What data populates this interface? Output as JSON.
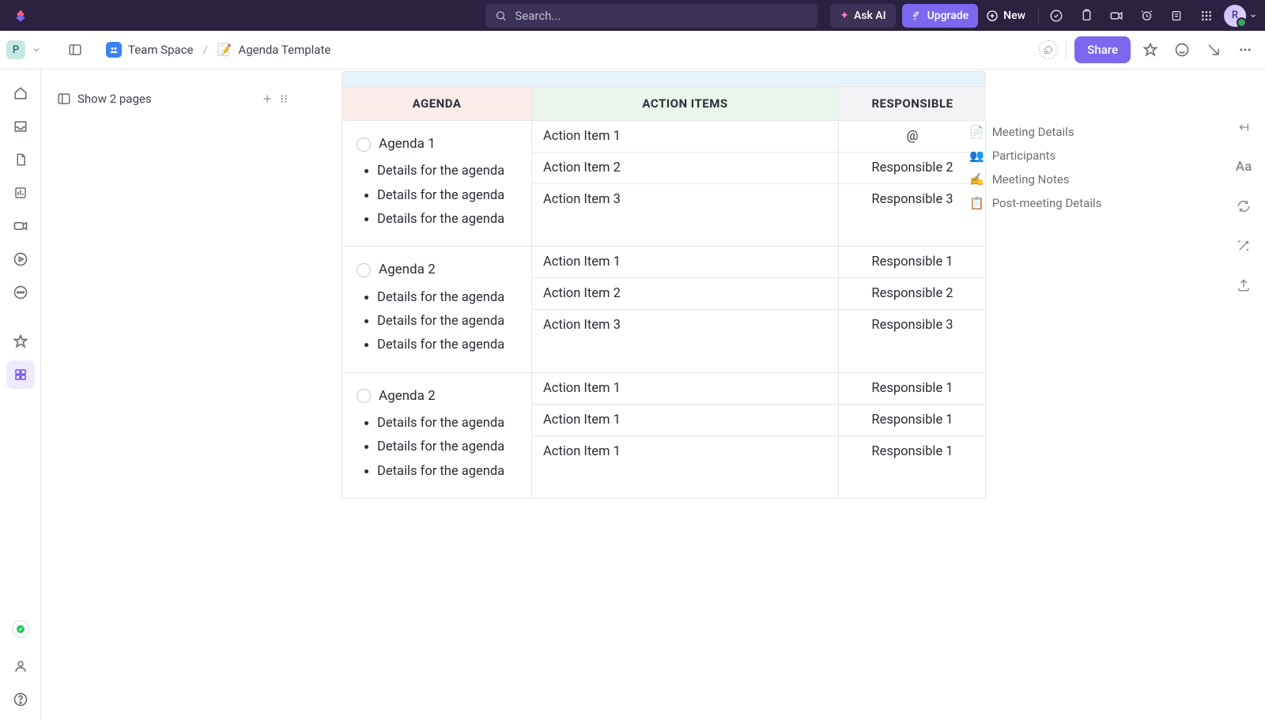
{
  "topbar": {
    "search_placeholder": "Search...",
    "ask_ai": "Ask AI",
    "upgrade": "Upgrade",
    "new": "New",
    "avatar_initial": "R"
  },
  "breadcrumb": {
    "workspace_initial": "P",
    "space": "Team Space",
    "page_icon": "📝",
    "page": "Agenda Template",
    "share": "Share"
  },
  "sidebar": {
    "show_pages": "Show 2 pages"
  },
  "table": {
    "headers": {
      "agenda": "AGENDA",
      "action": "ACTION ITEMS",
      "responsible": "RESPONSIBLE"
    },
    "rows": [
      {
        "title": "Agenda 1",
        "details": [
          "Details for the agen­da",
          "Details for the agen­da",
          "Details for the agen­da"
        ],
        "actions": [
          "Action Item 1",
          "Action Item 2",
          "Action Item 3"
        ],
        "responsible": [
          "@",
          "Responsible 2",
          "Responsible 3"
        ]
      },
      {
        "title": "Agenda 2",
        "details": [
          "Details for the agen­da",
          "Details for the agen­da",
          "Details for the agen­da"
        ],
        "actions": [
          "Action Item 1",
          "Action Item 2",
          "Action Item 3"
        ],
        "responsible": [
          "Responsible 1",
          "Responsible 2",
          "Responsible 3"
        ]
      },
      {
        "title": "Agenda 2",
        "details": [
          "Details for the agen­da",
          "Details for the agen­da",
          "Details for the agen­da"
        ],
        "actions": [
          "Action Item 1",
          "Action Item 1",
          "Action Item 1"
        ],
        "responsible": [
          "Responsible 1",
          "Responsible 1",
          "Responsible 1"
        ]
      }
    ]
  },
  "outline": {
    "items": [
      {
        "icon": "📄",
        "label": "Meeting Details"
      },
      {
        "icon": "👥",
        "label": "Participants"
      },
      {
        "icon": "✍️",
        "label": "Meeting Notes"
      },
      {
        "icon": "📋",
        "label": "Post-meeting Details"
      }
    ]
  }
}
